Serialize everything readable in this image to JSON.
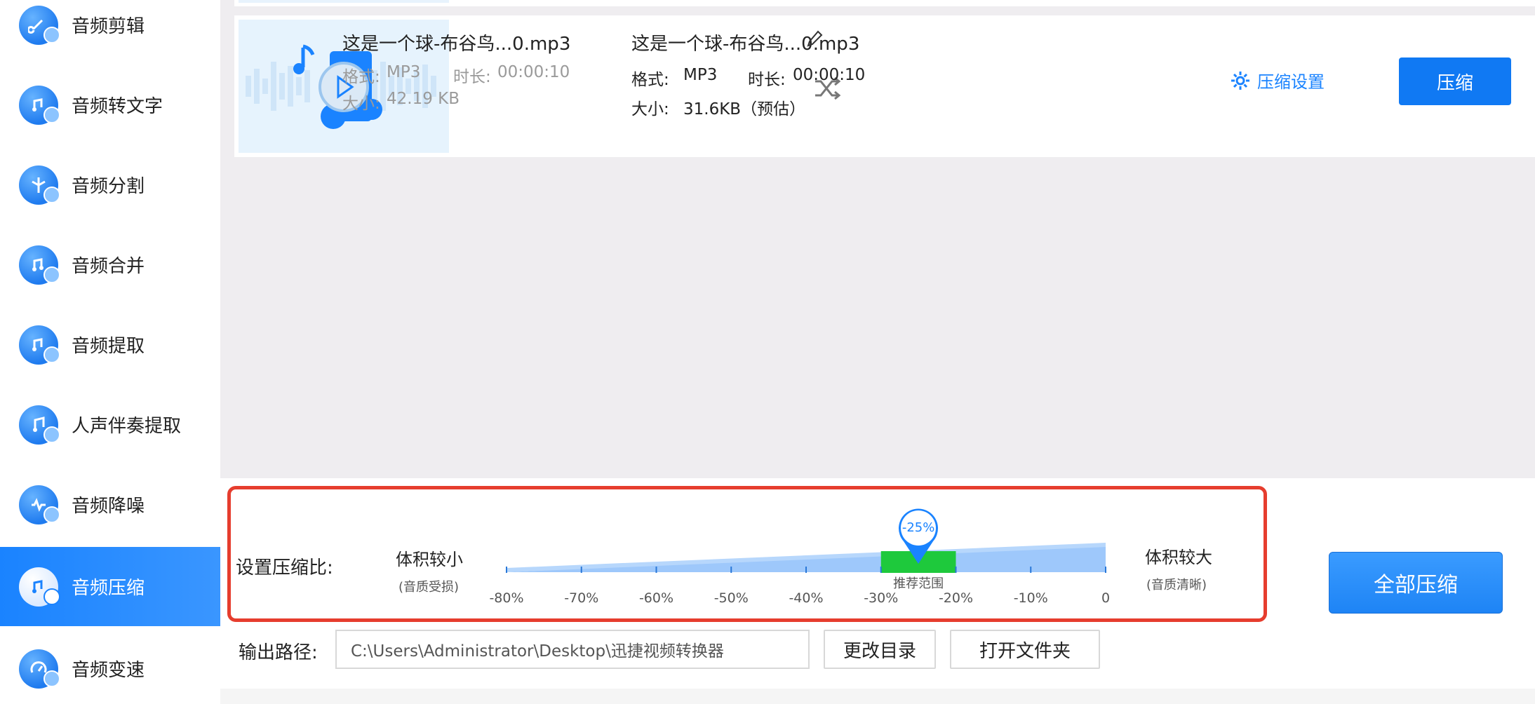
{
  "sidebar": {
    "items": [
      {
        "label": "音频剪辑",
        "icon": "audio-cut-icon"
      },
      {
        "label": "音频转文字",
        "icon": "audio-to-text-icon"
      },
      {
        "label": "音频分割",
        "icon": "audio-split-icon"
      },
      {
        "label": "音频合并",
        "icon": "audio-merge-icon"
      },
      {
        "label": "音频提取",
        "icon": "audio-extract-icon"
      },
      {
        "label": "人声伴奏提取",
        "icon": "vocal-extract-icon"
      },
      {
        "label": "音频降噪",
        "icon": "audio-denoise-icon"
      },
      {
        "label": "音频压缩",
        "icon": "audio-compress-icon",
        "active": true
      },
      {
        "label": "音频变速",
        "icon": "audio-speed-icon"
      }
    ]
  },
  "file": {
    "source": {
      "name": "这是一个球-布谷鸟...0.mp3",
      "format_label": "格式:",
      "format": "MP3",
      "duration_label": "时长:",
      "duration": "00:00:10",
      "size_label": "大小:",
      "size": "42.19 KB"
    },
    "output": {
      "name": "这是一个球-布谷鸟...0.mp3",
      "format_label": "格式:",
      "format": "MP3",
      "duration_label": "时长:",
      "duration": "00:00:10",
      "size_label": "大小:",
      "size": "31.6KB（预估）"
    },
    "settings_label": "压缩设置",
    "compress_button": "压缩"
  },
  "ratio": {
    "label": "设置压缩比:",
    "left_title": "体积较小",
    "left_note": "(音质受损)",
    "right_title": "体积较大",
    "right_note": "(音质清晰)",
    "ticks": [
      "-80%",
      "-70%",
      "-60%",
      "-50%",
      "-40%",
      "-30%",
      "-20%",
      "-10%",
      "0"
    ],
    "recommended_label": "推荐范围",
    "recommended_range": [
      -30,
      -20
    ],
    "current_value": -25,
    "current_label": "-25%"
  },
  "actions": {
    "compress_all": "全部压缩"
  },
  "output_path": {
    "label": "输出路径:",
    "value": "C:\\Users\\Administrator\\Desktop\\迅捷视频转换器",
    "change_dir": "更改目录",
    "open_folder": "打开文件夹"
  },
  "colors": {
    "accent": "#1a83ff",
    "button": "#1079f3",
    "highlight_border": "#e63d2e",
    "recommended": "#1ec93c"
  }
}
